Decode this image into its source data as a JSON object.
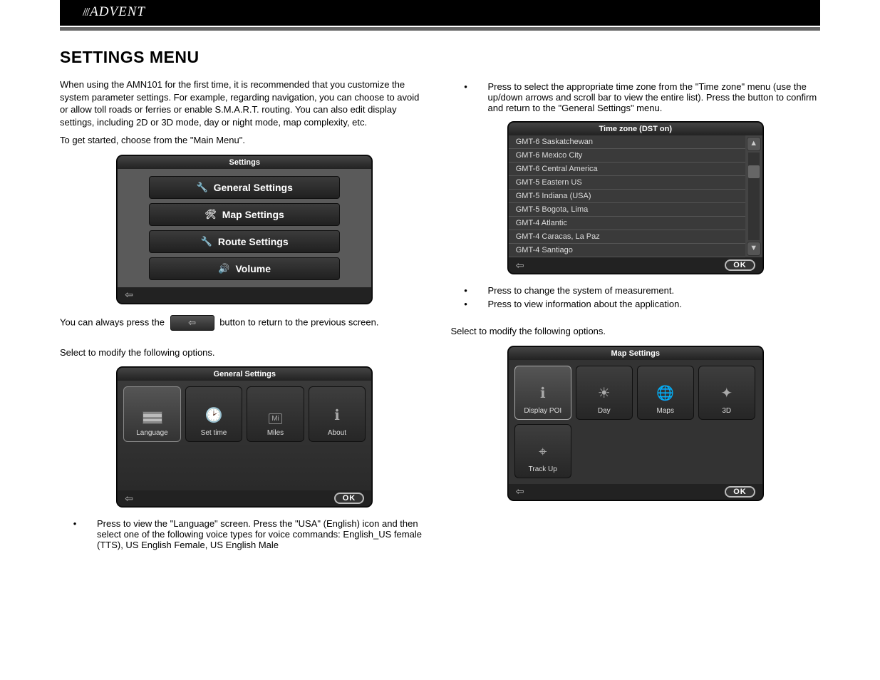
{
  "brand": "ADVENT",
  "title": "SETTINGS MENU",
  "intro1": "When using the AMN101 for the first time, it is recommended that you customize the system parameter settings. For example, regarding navigation, you can choose to avoid or allow toll roads or ferries or enable S.M.A.R.T. routing. You can also edit display settings, including 2D or 3D mode, day or night mode, map complexity, etc.",
  "intro2a": "To get started, choose ",
  "intro2b": " from the \"Main Menu\".",
  "settings_panel": {
    "title": "Settings",
    "items": [
      "General Settings",
      "Map Settings",
      "Route Settings",
      "Volume"
    ]
  },
  "back_line_a": "You can always press the ",
  "back_line_b": " button to return to the previous screen.",
  "gen_select_a": "Select ",
  "gen_select_b": " to modify the following options.",
  "general_panel": {
    "title": "General Settings",
    "tiles": [
      "Language",
      "Set time",
      "Miles",
      "About"
    ]
  },
  "lang_bullet": "Press              to view the \"Language\" screen. Press the \"USA\" (English) icon and then select one of the following voice types for voice commands: English_US female (TTS), US English Female, US English Male",
  "tz_bullet": "Press              to select the appropriate time zone from the \"Time zone\" menu (use the up/down arrows and scroll bar to view the entire list). Press the       button to confirm and return to the \"General Settings\" menu.",
  "tz_panel": {
    "title": "Time zone (DST on)",
    "rows": [
      "GMT-6 Saskatchewan",
      "GMT-6 Mexico City",
      "GMT-6 Central America",
      "GMT-5 Eastern US",
      "GMT-5 Indiana (USA)",
      "GMT-5 Bogota, Lima",
      "GMT-4 Atlantic",
      "GMT-4 Caracas, La Paz",
      "GMT-4 Santiago"
    ]
  },
  "measure_bullet": "Press                    to change the system of measurement.",
  "about_bullet": "Press            to view information about the application.",
  "map_select_a": "Select ",
  "map_select_b": " to modify the following options.",
  "map_panel": {
    "title": "Map Settings",
    "tiles": [
      "Display POI",
      "Day",
      "Maps",
      "3D",
      "Track Up"
    ]
  },
  "ok_label": "OK"
}
